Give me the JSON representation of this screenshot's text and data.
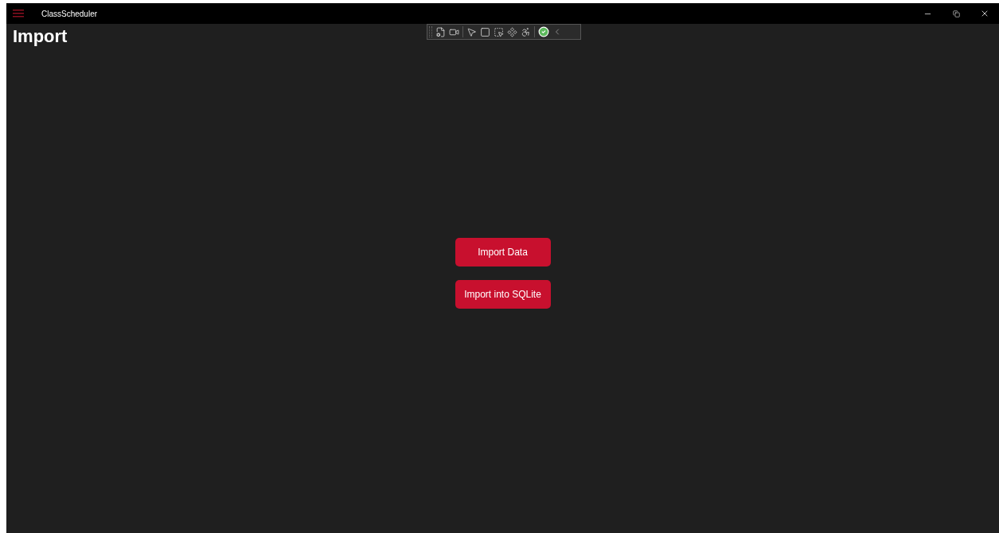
{
  "window": {
    "title": "ClassScheduler"
  },
  "page": {
    "heading": "Import"
  },
  "buttons": [
    {
      "label": "Import Data"
    },
    {
      "label": "Import into SQLite"
    }
  ]
}
